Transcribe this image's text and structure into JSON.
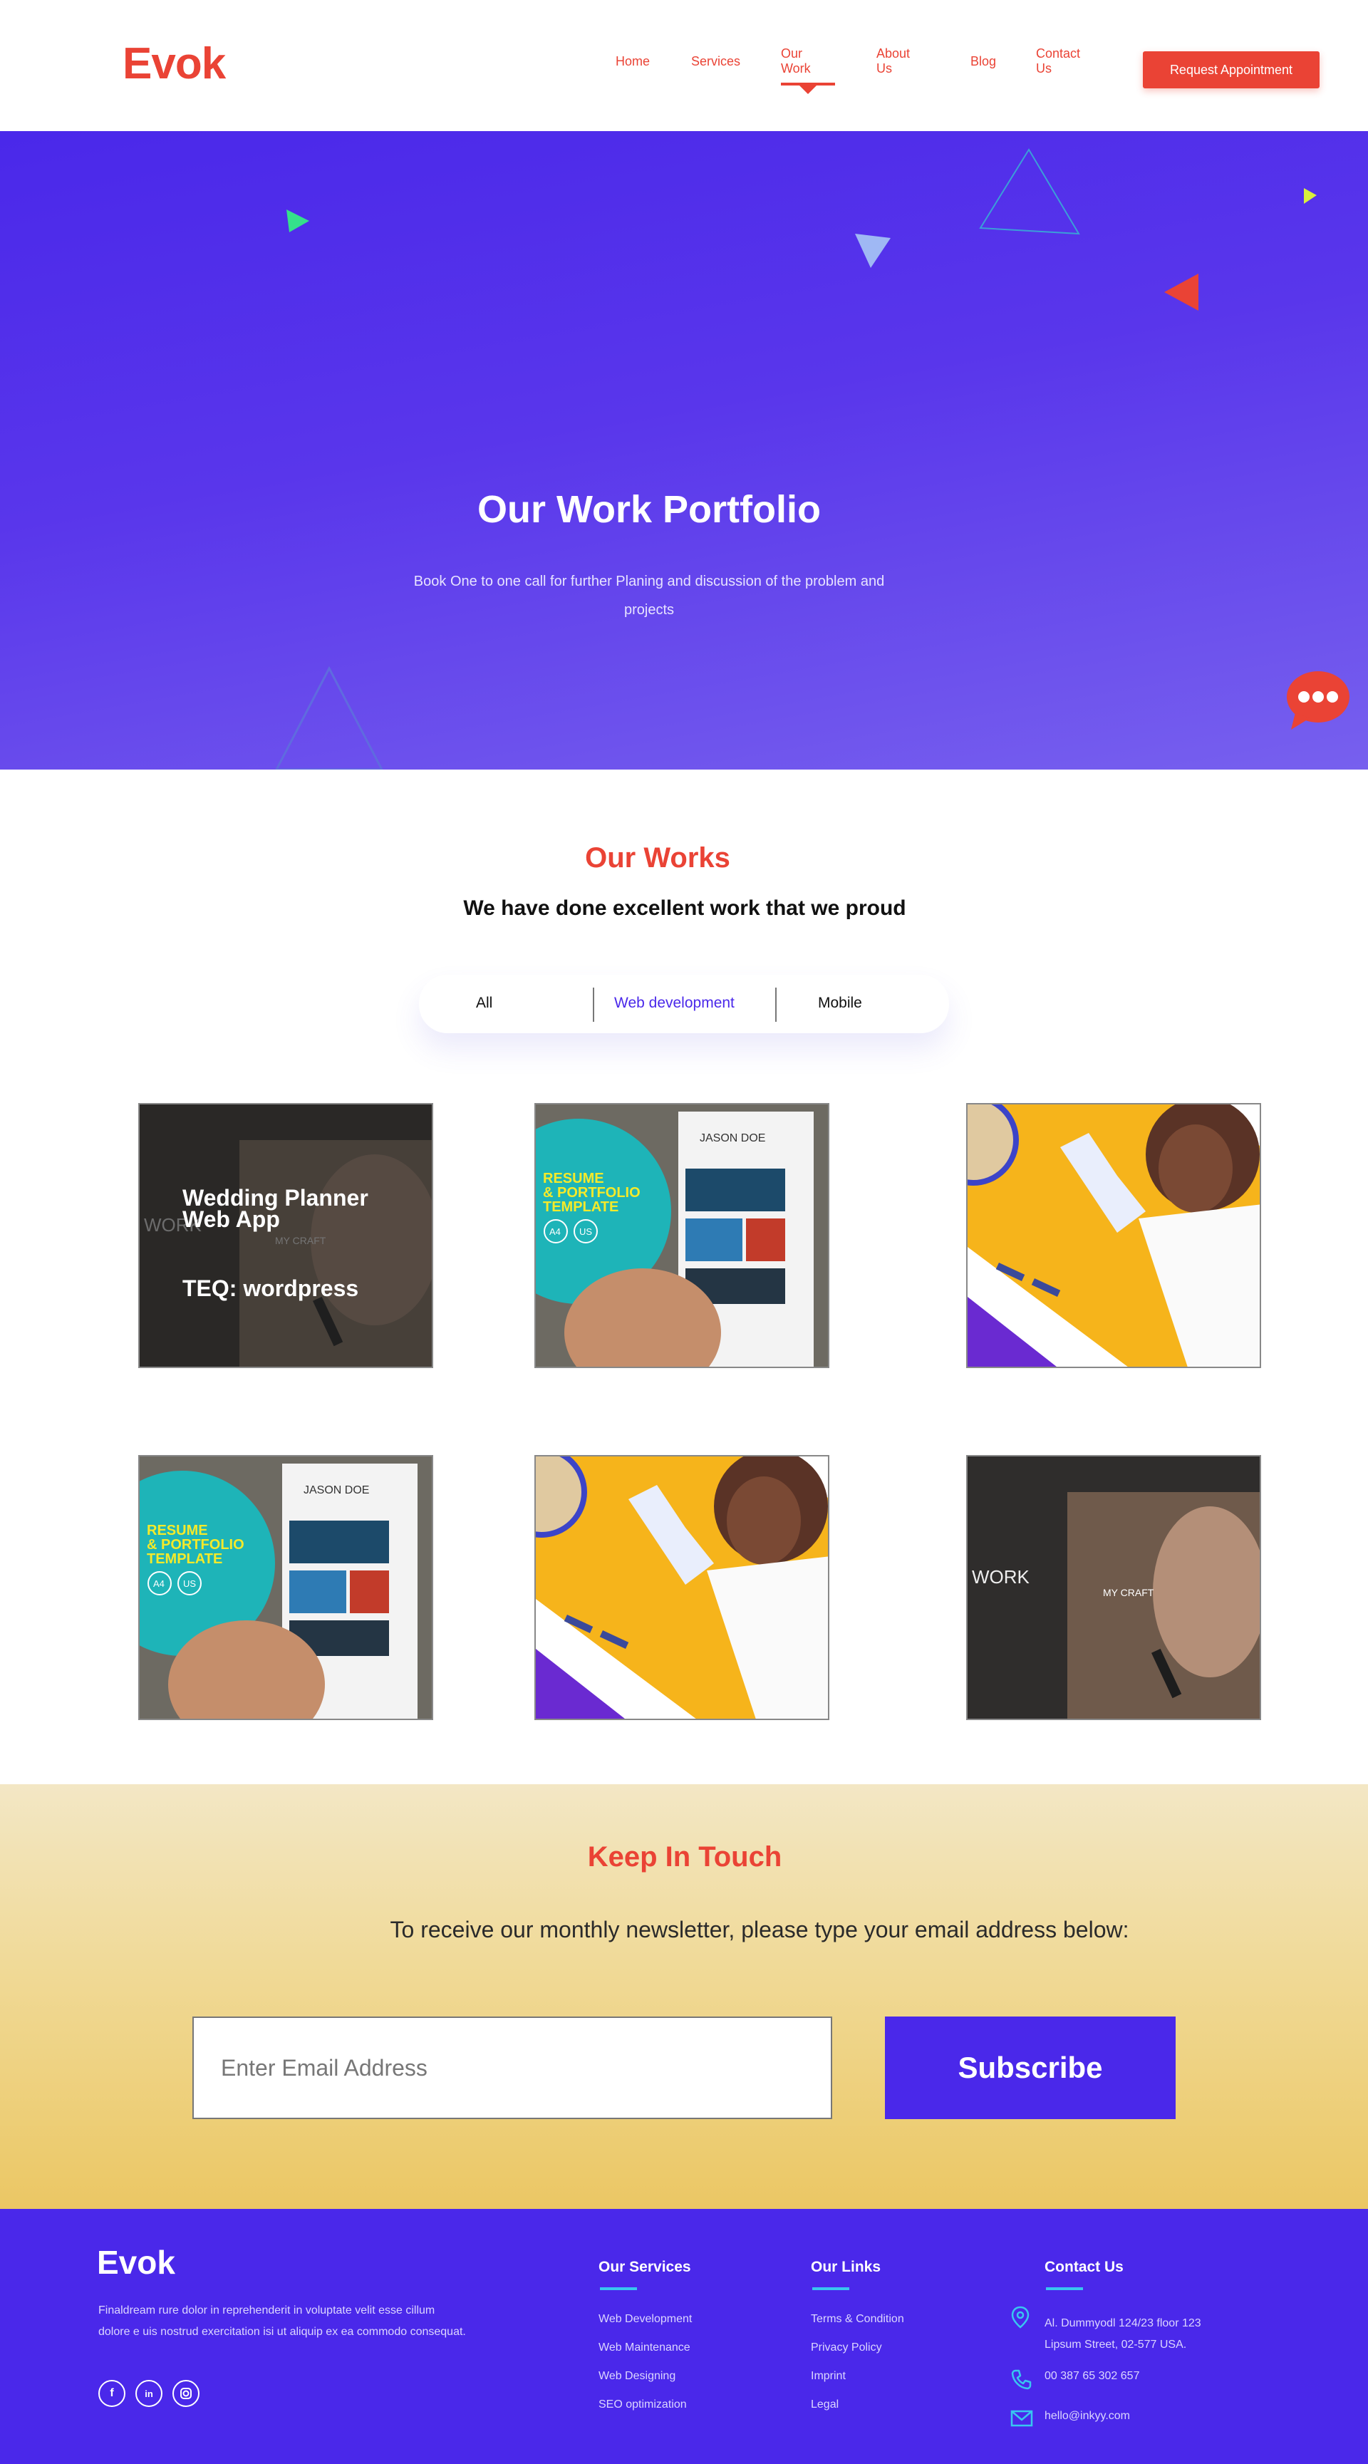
{
  "header": {
    "logo": "Evok",
    "nav": [
      "Home",
      "Services",
      "Our Work",
      "About Us",
      "Blog",
      "Contact Us"
    ],
    "active_nav": "Our Work",
    "cta": "Request  Appointment"
  },
  "hero": {
    "title": "Our Work Portfolio",
    "subtitle": "Book One to one call for further Planing and discussion of the problem and projects"
  },
  "works": {
    "title": "Our Works",
    "subtitle": "We have done excellent work that we proud",
    "filters": [
      "All",
      "Web development",
      "Mobile"
    ],
    "active_filter": "Web development",
    "cards": [
      {
        "type": "craft-overlay",
        "title": "Wedding Planner Web App",
        "teq": "TEQ: wordpress"
      },
      {
        "type": "resume"
      },
      {
        "type": "illustration"
      },
      {
        "type": "resume"
      },
      {
        "type": "illustration"
      },
      {
        "type": "craft"
      }
    ],
    "resume_text": {
      "line1": "RESUME",
      "line2": "& PORTFOLIO",
      "line3": "TEMPLATE",
      "a4": "A4",
      "us": "US",
      "name": "JASON DOE"
    },
    "craft_text": {
      "work": "WORK",
      "craft": "MY CRAFT"
    }
  },
  "newsletter": {
    "title": "Keep In Touch",
    "subtitle": "To receive our monthly newsletter, please type your email address below:",
    "placeholder": "Enter Email Address",
    "button": "Subscribe"
  },
  "footer": {
    "logo": "Evok",
    "description": "Finaldream rure dolor in reprehenderit in voluptate velit esse cillum dolore e uis nostrud exercitation isi ut aliquip ex ea commodo consequat.",
    "social": [
      "f",
      "in",
      "ig"
    ],
    "services": {
      "title": "Our Services",
      "items": [
        "Web Development",
        "Web Maintenance",
        "Web Designing",
        "SEO optimization"
      ]
    },
    "links": {
      "title": "Our Links",
      "items": [
        "Terms & Condition",
        "Privacy Policy",
        "Imprint",
        "Legal"
      ]
    },
    "contact": {
      "title": "Contact Us",
      "address": "Al. Dummyodl 124/23 floor 123 Lipsum Street, 02-577 USA.",
      "phone": "00 387 65 302 657",
      "email": "hello@inkyy.com"
    }
  },
  "colors": {
    "brand_red": "#ea4335",
    "brand_purple": "#4a28ea",
    "accent_cyan": "#38c6f0"
  }
}
